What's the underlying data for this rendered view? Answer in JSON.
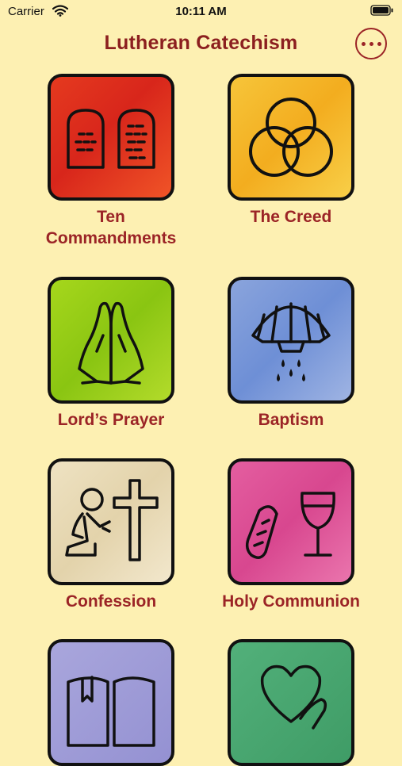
{
  "status_bar": {
    "carrier": "Carrier",
    "time": "10:11 AM"
  },
  "header": {
    "title": "Lutheran Catechism"
  },
  "tiles": [
    {
      "line1": "Ten",
      "line2": "Commandments",
      "icon": "stone-tablets-icon",
      "color": "#e03a1f"
    },
    {
      "line1": "The Creed",
      "line2": "",
      "icon": "trinity-circles-icon",
      "color": "#f4b62b"
    },
    {
      "line1": "Lord’s Prayer",
      "line2": "",
      "icon": "praying-hands-icon",
      "color": "#9ccf17"
    },
    {
      "line1": "Baptism",
      "line2": "",
      "icon": "shell-water-icon",
      "color": "#7c98d8"
    },
    {
      "line1": "Confession",
      "line2": "",
      "icon": "kneeling-cross-icon",
      "color": "#e8dab6"
    },
    {
      "line1": "Holy Communion",
      "line2": "",
      "icon": "bread-chalice-icon",
      "color": "#df5499"
    },
    {
      "icon": "bible-icon",
      "color": "#9f9cd7"
    },
    {
      "icon": "heart-hand-icon",
      "color": "#48a66f"
    }
  ]
}
